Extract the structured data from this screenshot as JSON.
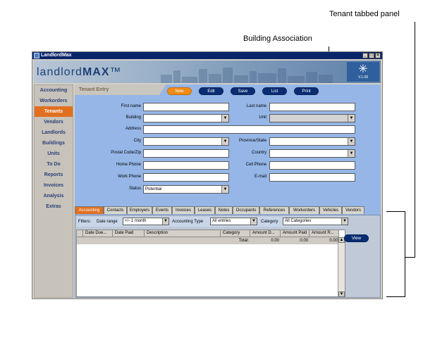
{
  "annotations": {
    "tabbed_panel": "Tenant tabbed panel",
    "building_association": "Building Association"
  },
  "window": {
    "title": "LandlordMax",
    "buttons": [
      "_",
      "□",
      "×"
    ]
  },
  "banner": {
    "logo_light": "landlord",
    "logo_bold": "MAX",
    "tm": "™",
    "version": "V.1.08"
  },
  "sidebar": {
    "items": [
      {
        "label": "Accounting"
      },
      {
        "label": "Workorders"
      },
      {
        "label": "Tenants"
      },
      {
        "label": "Vendors"
      },
      {
        "label": "Landlords"
      },
      {
        "label": "Buildings"
      },
      {
        "label": "Units"
      },
      {
        "label": "To Do"
      },
      {
        "label": "Reports"
      },
      {
        "label": "Invoices"
      },
      {
        "label": "Analysis"
      },
      {
        "label": "Extras"
      }
    ],
    "active": "Tenants"
  },
  "header": {
    "title": "Tenant Entry",
    "buttons": {
      "new": "New",
      "edit": "Edit",
      "save": "Save",
      "list": "List",
      "print": "Print"
    }
  },
  "form": {
    "first_name": {
      "label": "First name",
      "value": ""
    },
    "last_name": {
      "label": "Last name",
      "value": ""
    },
    "building": {
      "label": "Building",
      "value": ""
    },
    "unit": {
      "label": "Unit",
      "value": ""
    },
    "address": {
      "label": "Address",
      "value": ""
    },
    "city": {
      "label": "City",
      "value": ""
    },
    "province": {
      "label": "Province/State",
      "value": ""
    },
    "postal": {
      "label": "Postal Code/Zip",
      "value": ""
    },
    "country": {
      "label": "Country",
      "value": ""
    },
    "home_phone": {
      "label": "Home Phone",
      "value": ""
    },
    "cell_phone": {
      "label": "Cell Phone",
      "value": ""
    },
    "work_phone": {
      "label": "Work Phone",
      "value": ""
    },
    "email": {
      "label": "E-mail",
      "value": ""
    },
    "status": {
      "label": "Status",
      "value": "Potential"
    }
  },
  "tabs": [
    {
      "label": "Accounting"
    },
    {
      "label": "Contacts"
    },
    {
      "label": "Employers"
    },
    {
      "label": "Events"
    },
    {
      "label": "Invoices"
    },
    {
      "label": "Leases"
    },
    {
      "label": "Notes"
    },
    {
      "label": "Occupants"
    },
    {
      "label": "References"
    },
    {
      "label": "Workorders"
    },
    {
      "label": "Vehicles"
    },
    {
      "label": "Vendors"
    }
  ],
  "filters": {
    "filters_label": "Filters:",
    "date_range_label": "Date range",
    "date_range_value": "+/- 1 month",
    "accounting_type_label": "Accounting Type",
    "accounting_type_value": "All entries",
    "category_label": "Category",
    "category_value": "All Categories"
  },
  "table": {
    "columns": [
      "Date Due...",
      "Date Paid",
      "Description",
      "Category",
      "Amount D...",
      "Amount Paid",
      "Amount R..."
    ],
    "total_row": {
      "label": "Total:",
      "amount_due": "0.00",
      "amount_paid": "0.00",
      "amount_remaining": "0.00"
    }
  },
  "panel_buttons": {
    "view": "View"
  }
}
